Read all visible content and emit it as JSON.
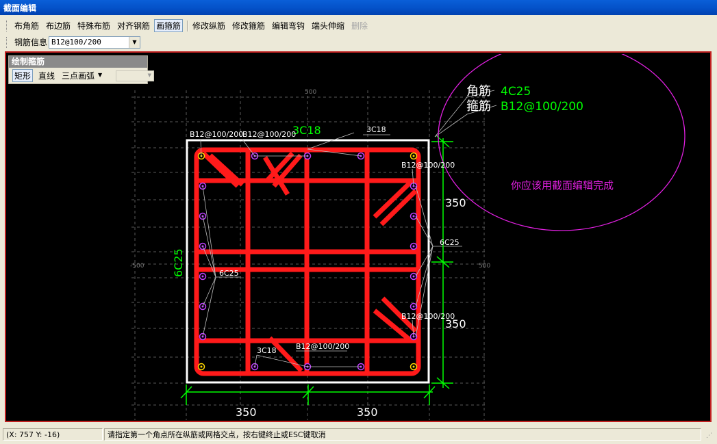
{
  "window": {
    "title": "截面编辑"
  },
  "toolbar": {
    "buttons": [
      {
        "label": "布角筋"
      },
      {
        "label": "布边筋"
      },
      {
        "label": "特殊布筋"
      },
      {
        "label": "对齐钢筋"
      },
      {
        "label": "画箍筋"
      },
      {
        "label": "修改纵筋"
      },
      {
        "label": "修改箍筋"
      },
      {
        "label": "编辑弯钩"
      },
      {
        "label": "端头伸缩"
      },
      {
        "label": "删除"
      }
    ],
    "rebar_info_label": "钢筋信息",
    "rebar_info_value": "B12@100/200"
  },
  "palette": {
    "title": "绘制箍筋",
    "items": [
      {
        "label": "矩形"
      },
      {
        "label": "直线"
      },
      {
        "label": "三点画弧"
      }
    ]
  },
  "drawing": {
    "grid_labels": {
      "top": "500",
      "left": "-500",
      "right": "500"
    },
    "legend": {
      "corner_label": "角筋",
      "corner_value": "4C25",
      "stirrup_label": "箍筋",
      "stirrup_value": "B12@100/200"
    },
    "annotation_note": "你应该用截面编辑完成",
    "labels": {
      "top_side_rebar": "3C18",
      "top_leader_rebar": "3C18",
      "left_side_rebar": "6C25",
      "left_leader_rebar": "6C25",
      "right_leader_rebar": "6C25",
      "bottom_leader_rebar": "3C18",
      "stirrup_top_left": "B12@100/200",
      "stirrup_top_mid": "B12@100/200",
      "stirrup_right_upper": "B12@100/200",
      "stirrup_right_lower": "B12@100/200",
      "stirrup_bottom": "B12@100/200"
    },
    "dimensions": {
      "bottom_left": "350",
      "bottom_right": "350",
      "right_upper": "350",
      "right_lower": "350"
    },
    "colors": {
      "background": "#000000",
      "rebar": "#FF1A1A",
      "section_outline": "#FFFFFF",
      "dimension": "#00FF00",
      "annotation": "#E020E0"
    }
  },
  "status": {
    "coords": "(X: 757 Y: -16)",
    "message": "请指定第一个角点所在纵筋或网格交点，按右键终止或ESC键取消"
  }
}
